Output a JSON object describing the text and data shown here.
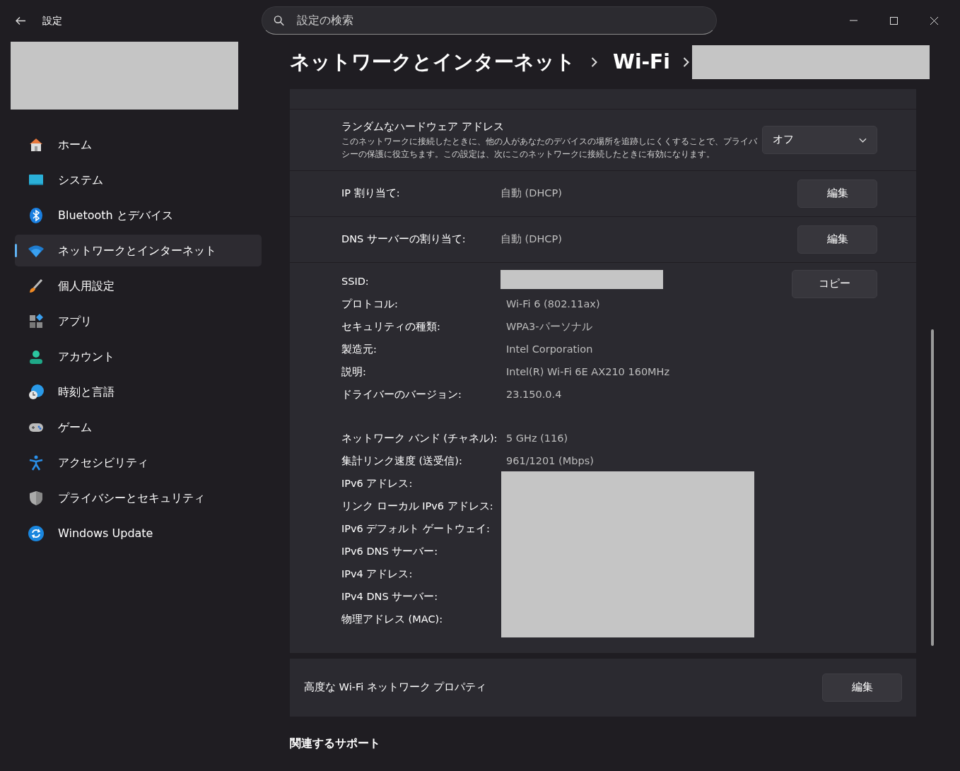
{
  "window": {
    "title": "設定"
  },
  "search": {
    "placeholder": "設定の検索"
  },
  "sidebar": {
    "items": [
      {
        "label": "ホーム",
        "selected": false
      },
      {
        "label": "システム",
        "selected": false
      },
      {
        "label": "Bluetooth とデバイス",
        "selected": false
      },
      {
        "label": "ネットワークとインターネット",
        "selected": true
      },
      {
        "label": "個人用設定",
        "selected": false
      },
      {
        "label": "アプリ",
        "selected": false
      },
      {
        "label": "アカウント",
        "selected": false
      },
      {
        "label": "時刻と言語",
        "selected": false
      },
      {
        "label": "ゲーム",
        "selected": false
      },
      {
        "label": "アクセシビリティ",
        "selected": false
      },
      {
        "label": "プライバシーとセキュリティ",
        "selected": false
      },
      {
        "label": "Windows Update",
        "selected": false
      }
    ]
  },
  "breadcrumb": [
    "ネットワークとインターネット",
    "Wi-Fi"
  ],
  "settings": [
    {
      "kind": "dropdown",
      "title": "ランダムなハードウェア アドレス",
      "description": "このネットワークに接続したときに、他の人があなたのデバイスの場所を追跡しにくくすることで、プライバシーの保護に役立ちます。この設定は、次にこのネットワークに接続したときに有効になります。",
      "value": "オフ"
    },
    {
      "kind": "edit",
      "label": "IP 割り当て:",
      "value": "自動 (DHCP)",
      "button": "編集"
    },
    {
      "kind": "edit",
      "label": "DNS サーバーの割り当て:",
      "value": "自動 (DHCP)",
      "button": "編集"
    }
  ],
  "properties": {
    "button": "コピー",
    "groups": [
      {
        "rows": [
          {
            "label": "SSID:"
          },
          {
            "label": "プロトコル:",
            "value": "Wi-Fi 6 (802.11ax)"
          },
          {
            "label": "セキュリティの種類:",
            "value": "WPA3-パーソナル"
          },
          {
            "label": "製造元:",
            "value": "Intel Corporation"
          },
          {
            "label": "説明:",
            "value": "Intel(R) Wi-Fi 6E AX210 160MHz"
          },
          {
            "label": "ドライバーのバージョン:",
            "value": "23.150.0.4"
          }
        ]
      },
      {
        "rows": [
          {
            "label": "ネットワーク バンド (チャネル):",
            "value": "5 GHz (116)"
          },
          {
            "label": "集計リンク速度 (送受信):",
            "value": "961/1201 (Mbps)"
          },
          {
            "label": "IPv6 アドレス:"
          },
          {
            "label": "リンク ローカル IPv6 アドレス:"
          },
          {
            "label": "IPv6 デフォルト ゲートウェイ:"
          },
          {
            "label": "IPv6 DNS サーバー:"
          },
          {
            "label": "IPv4 アドレス:"
          },
          {
            "label": "IPv4 DNS サーバー:"
          },
          {
            "label": "物理アドレス (MAC):"
          }
        ]
      }
    ]
  },
  "advanced": {
    "label": "高度な Wi-Fi ネットワーク プロパティ",
    "button": "編集"
  },
  "related": {
    "title": "関連するサポート"
  }
}
